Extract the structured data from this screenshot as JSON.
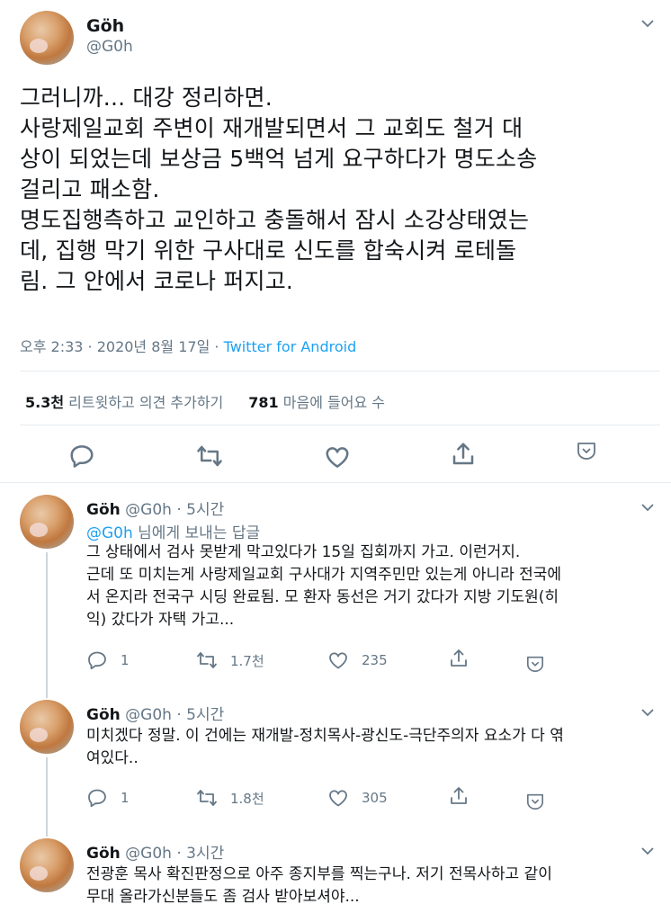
{
  "main_tweet": {
    "name": "Göh",
    "handle": "@G0h",
    "text": "그러니까... 대강 정리하면.\n사랑제일교회 주변이 재개발되면서 그 교회도 철거 대\n상이 되었는데 보상금 5백억 넘게 요구하다가 명도소송\n걸리고 패소함.\n명도집행측하고 교인하고 충돌해서 잠시 소강상태였는\n데, 집행 막기 위한 구사대로 신도를 합숙시켜 로테돌\n림. 그 안에서 코로나 퍼지고.",
    "time": "오후 2:33 · 2020년 8월 17일 · ",
    "source": "Twitter for Android",
    "retweets_count": "5.3천",
    "retweets_label": "리트윗하고 의견 추가하기",
    "likes_count": "781",
    "likes_label": "마음에 들어요 수"
  },
  "replies": [
    {
      "name": "Göh",
      "meta": "@G0h · 5시간",
      "replying_handle": "@G0h",
      "replying_suffix": " 님에게 보내는 답글",
      "text": "그 상태에서 검사 못받게 막고있다가 15일 집회까지 가고. 이런거지.\n근데 또 미치는게 사랑제일교회 구사대가 지역주민만 있는게 아니라 전국에\n서 온지라 전국구 시딩 완료됨. 모 환자 동선은 거기 갔다가 지방 기도원(히\n익) 갔다가 자택 가고...",
      "reply_count": "1",
      "retweet_count": "1.7천",
      "like_count": "235"
    },
    {
      "name": "Göh",
      "meta": "@G0h · 5시간",
      "text": "미치겠다 정말. 이 건에는 재개발-정치목사-광신도-극단주의자 요소가 다 엮\n여있다..",
      "reply_count": "1",
      "retweet_count": "1.8천",
      "like_count": "305"
    },
    {
      "name": "Göh",
      "meta": "@G0h · 3시간",
      "text": "전광훈 목사 확진판정으로 아주 종지부를 찍는구나. 저기 전목사하고 같이\n무대 올라가신분들도 좀 검사 받아보셔야..."
    }
  ],
  "colors": {
    "accent": "#1da1f2",
    "muted": "#657786",
    "divider": "#e6ecf0"
  },
  "icons": [
    "chevron-down-icon",
    "reply-icon",
    "retweet-icon",
    "like-icon",
    "share-icon",
    "more-icon"
  ]
}
